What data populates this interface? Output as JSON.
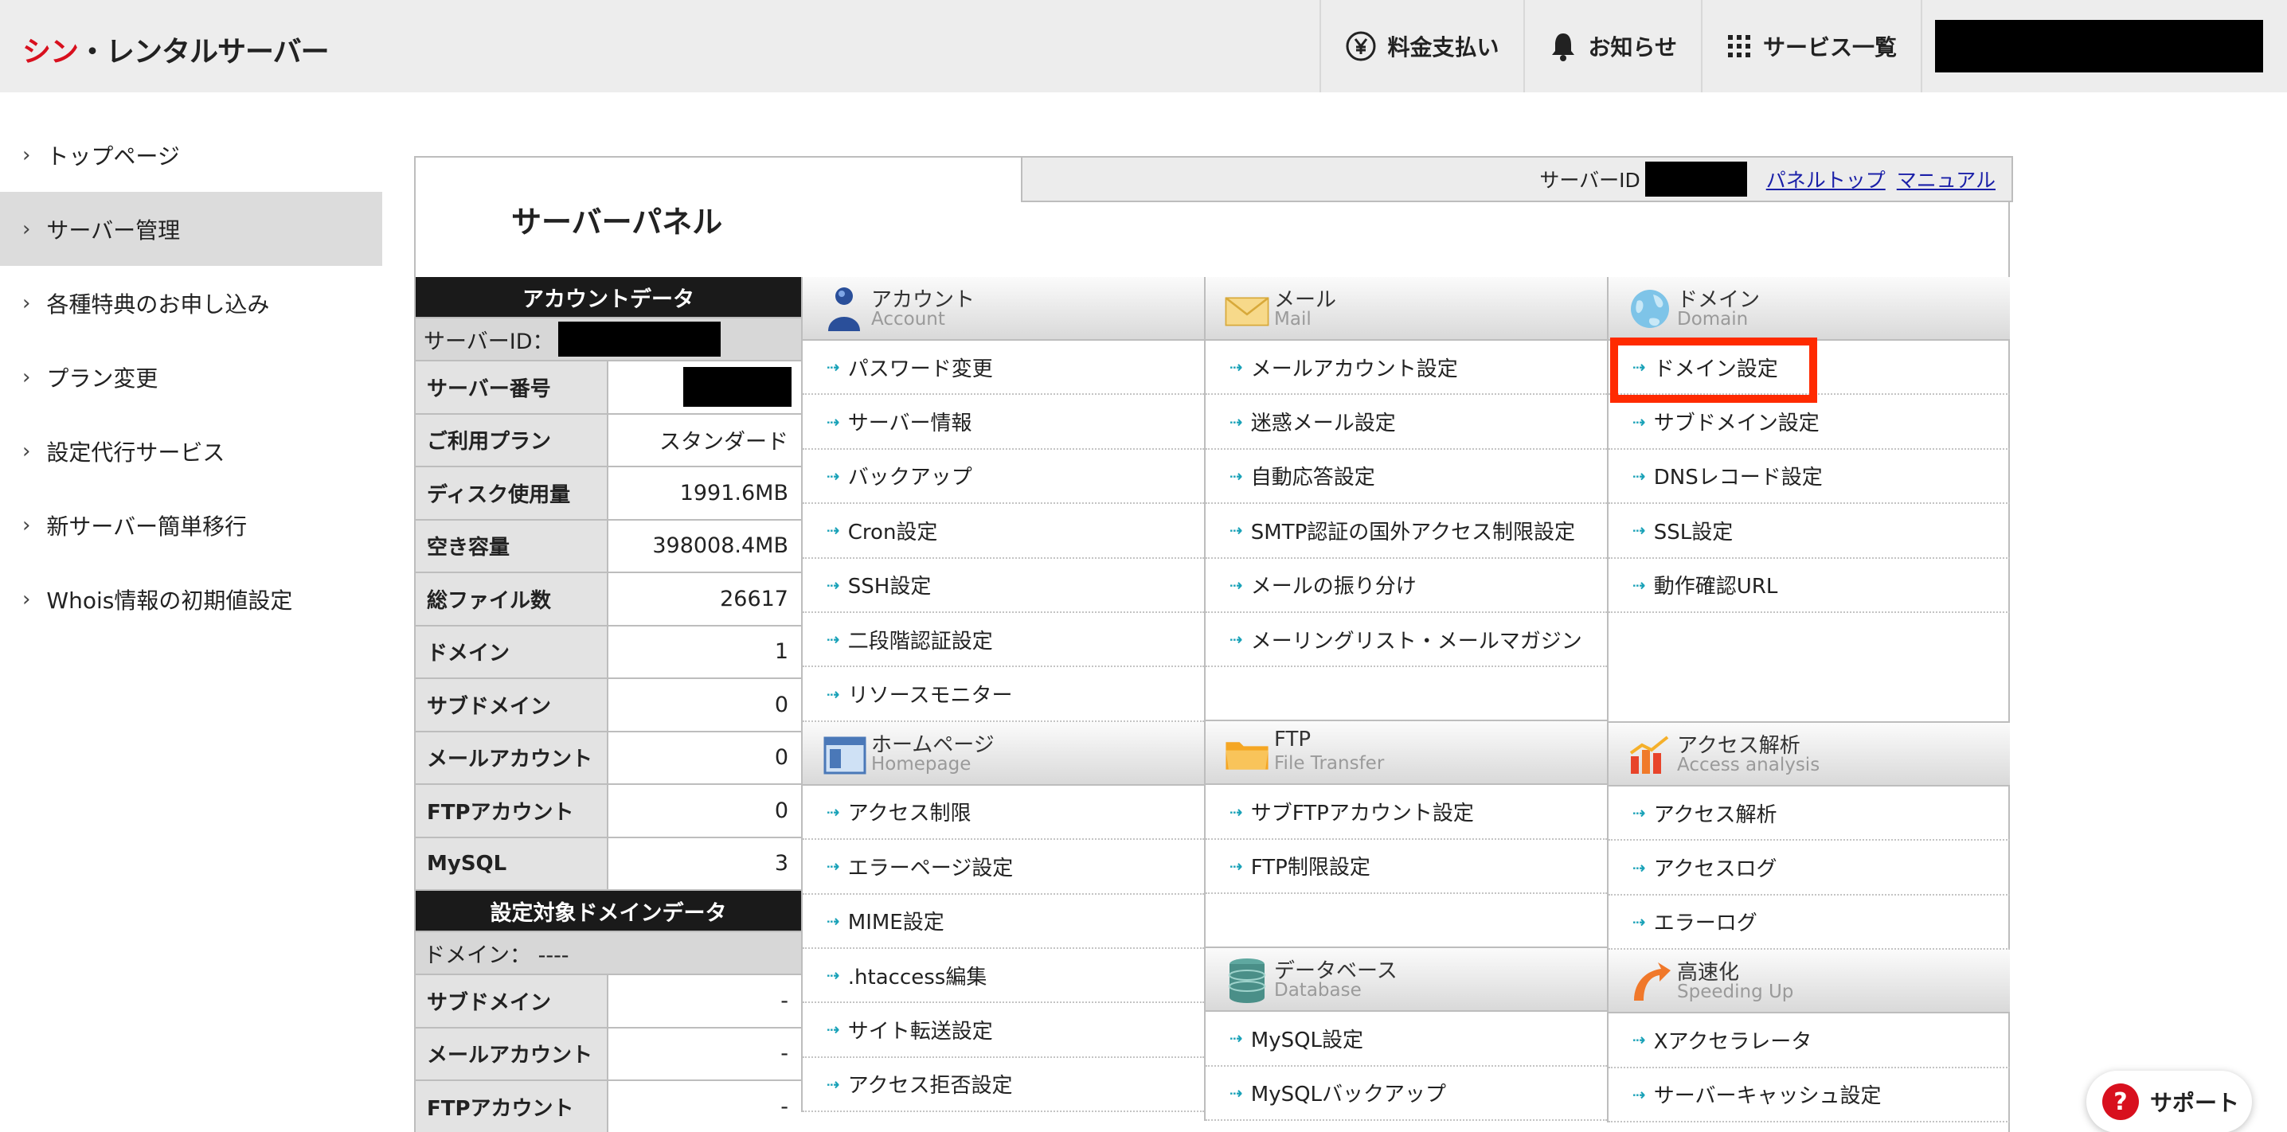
{
  "header": {
    "logo_red": "シン",
    "logo_rest": "・レンタルサーバー",
    "nav": [
      {
        "label": "料金支払い",
        "icon": "yen-icon"
      },
      {
        "label": "お知らせ",
        "icon": "bell-icon"
      },
      {
        "label": "サービス一覧",
        "icon": "grid-icon"
      }
    ]
  },
  "sidebar": {
    "items": [
      {
        "label": "トップページ"
      },
      {
        "label": "サーバー管理"
      },
      {
        "label": "各種特典のお申し込み"
      },
      {
        "label": "プラン変更"
      },
      {
        "label": "設定代行サービス"
      },
      {
        "label": "新サーバー簡単移行"
      },
      {
        "label": "Whois情報の初期値設定"
      }
    ]
  },
  "panel": {
    "title": "サーバーパネル",
    "topbar": {
      "server_id_label": "サーバーID",
      "panel_top_link": "パネルトップ",
      "manual_link": "マニュアル"
    }
  },
  "account_data": {
    "header": "アカウントデータ",
    "server_id_label": "サーバーID：",
    "rows": [
      {
        "key": "サーバー番号",
        "value": ""
      },
      {
        "key": "ご利用プラン",
        "value": "スタンダード"
      },
      {
        "key": "ディスク使用量",
        "value": "1991.6MB"
      },
      {
        "key": "空き容量",
        "value": "398008.4MB"
      },
      {
        "key": "総ファイル数",
        "value": "26617"
      },
      {
        "key": "ドメイン",
        "value": "1"
      },
      {
        "key": "サブドメイン",
        "value": "0"
      },
      {
        "key": "メールアカウント",
        "value": "0"
      },
      {
        "key": "FTPアカウント",
        "value": "0"
      },
      {
        "key": "MySQL",
        "value": "3"
      }
    ]
  },
  "domain_data": {
    "header": "設定対象ドメインデータ",
    "domain_label": "ドメイン： ----",
    "rows": [
      {
        "key": "サブドメイン",
        "value": "-"
      },
      {
        "key": "メールアカウント",
        "value": "-"
      },
      {
        "key": "FTPアカウント",
        "value": "-"
      }
    ]
  },
  "menus": {
    "account": {
      "jp": "アカウント",
      "en": "Account",
      "items": [
        "パスワード変更",
        "サーバー情報",
        "バックアップ",
        "Cron設定",
        "SSH設定",
        "二段階認証設定",
        "リソースモニター"
      ]
    },
    "mail": {
      "jp": "メール",
      "en": "Mail",
      "items": [
        "メールアカウント設定",
        "迷惑メール設定",
        "自動応答設定",
        "SMTP認証の国外アクセス制限設定",
        "メールの振り分け",
        "メーリングリスト・メールマガジン"
      ]
    },
    "domain": {
      "jp": "ドメイン",
      "en": "Domain",
      "items": [
        "ドメイン設定",
        "サブドメイン設定",
        "DNSレコード設定",
        "SSL設定",
        "動作確認URL"
      ]
    },
    "homepage": {
      "jp": "ホームページ",
      "en": "Homepage",
      "items": [
        "アクセス制限",
        "エラーページ設定",
        "MIME設定",
        ".htaccess編集",
        "サイト転送設定",
        "アクセス拒否設定"
      ]
    },
    "ftp": {
      "jp": "FTP",
      "en": "File Transfer",
      "items": [
        "サブFTPアカウント設定",
        "FTP制限設定"
      ]
    },
    "access": {
      "jp": "アクセス解析",
      "en": "Access analysis",
      "items": [
        "アクセス解析",
        "アクセスログ",
        "エラーログ"
      ]
    },
    "database": {
      "jp": "データベース",
      "en": "Database",
      "items": [
        "MySQL設定",
        "MySQLバックアップ"
      ]
    },
    "speed": {
      "jp": "高速化",
      "en": "Speeding Up",
      "items": [
        "Xアクセラレータ",
        "サーバーキャッシュ設定"
      ]
    }
  },
  "support": {
    "label": "サポート"
  },
  "colors": {
    "brand_red": "#d8101e",
    "highlight": "#ff2a00",
    "link": "#1a1fa8",
    "arrow": "#1aa2b8"
  }
}
